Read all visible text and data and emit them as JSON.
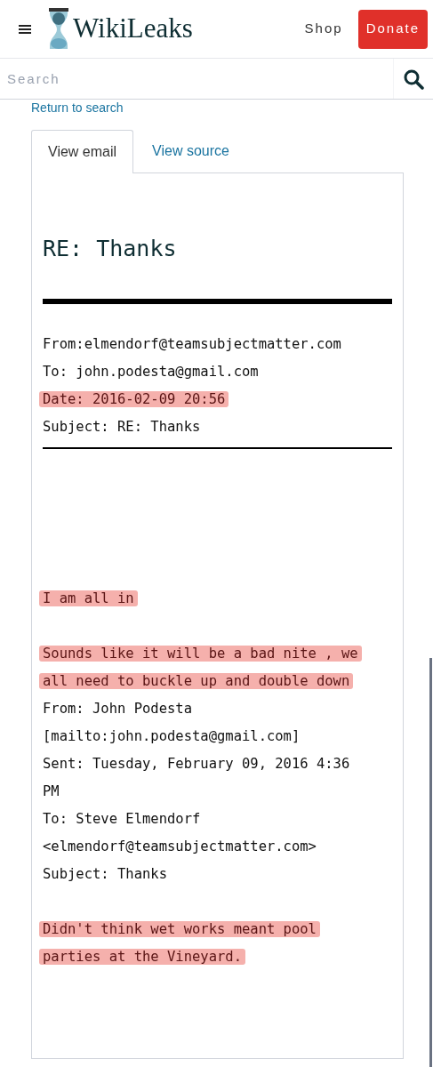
{
  "header": {
    "brand": "WikiLeaks",
    "links": [
      {
        "label": "Shop",
        "kind": "link"
      },
      {
        "label": "Donate",
        "kind": "button"
      }
    ]
  },
  "search": {
    "placeholder": "Search"
  },
  "return_link": "Return to search",
  "tabs": [
    {
      "label": "View email",
      "selected": true
    },
    {
      "label": "View source",
      "selected": false
    }
  ],
  "email": {
    "title": "RE: Thanks",
    "headers": [
      {
        "text": "From:elmendorf@teamsubjectmatter.com",
        "highlighted": false
      },
      {
        "text": "To: john.podesta@gmail.com",
        "highlighted": false
      },
      {
        "text": "Date: 2016-02-09 20:56",
        "highlighted": true
      },
      {
        "text": "Subject: RE: Thanks",
        "highlighted": false
      }
    ],
    "body": [
      [
        {
          "text": "I am all in",
          "highlighted": true
        }
      ],
      [
        {
          "text": "Sounds like it will be a bad nite , we",
          "highlighted": true
        },
        {
          "text": "all need to buckle up and double down",
          "highlighted": true
        },
        {
          "text": "From: John Podesta",
          "highlighted": false
        },
        {
          "text": "[mailto:john.podesta@gmail.com]",
          "highlighted": false
        },
        {
          "text": "Sent: Tuesday, February 09, 2016 4:36",
          "highlighted": false
        },
        {
          "text": "PM",
          "highlighted": false
        },
        {
          "text": "To: Steve Elmendorf",
          "highlighted": false
        },
        {
          "text": "<elmendorf@teamsubjectmatter.com>",
          "highlighted": false
        },
        {
          "text": "Subject: Thanks",
          "highlighted": false
        }
      ],
      [
        {
          "text": "Didn't think wet works meant pool",
          "highlighted": true
        },
        {
          "text": "parties at the Vineyard.",
          "highlighted": true
        }
      ]
    ]
  }
}
